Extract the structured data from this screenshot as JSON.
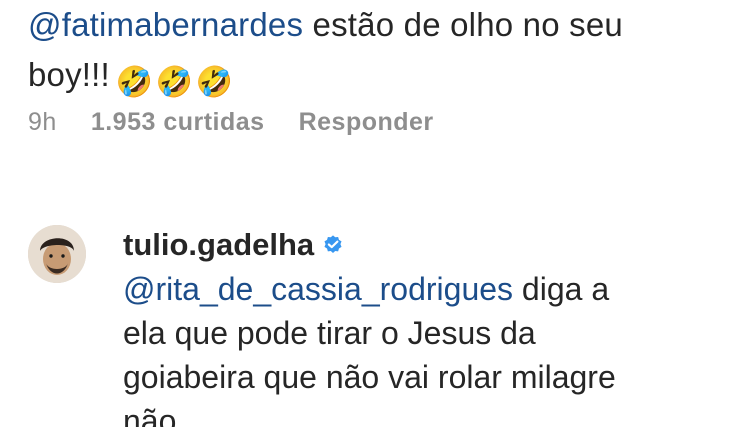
{
  "top_comment": {
    "mention": "@fatimabernardes",
    "text": " estão de olho no seu",
    "text2": "boy!!!",
    "emojis": [
      "🤣",
      "🤣",
      "🤣"
    ],
    "time": "9h",
    "likes": "1.953 curtidas",
    "reply_label": "Responder"
  },
  "reply": {
    "username": "tulio.gadelha",
    "mention": "@rita_de_cassia_rodrigues",
    "line1_rest": " diga a",
    "line2": "ela que pode tirar o Jesus da",
    "line3": "goiabeira que não vai rolar milagre",
    "line4": "não."
  },
  "colors": {
    "mention": "#1c4d8a",
    "meta": "#8e8e8e",
    "verified": "#3897f0"
  },
  "icons": {
    "verified": "verified-badge-icon",
    "emoji": "rolling-laughing-face-emoji"
  }
}
